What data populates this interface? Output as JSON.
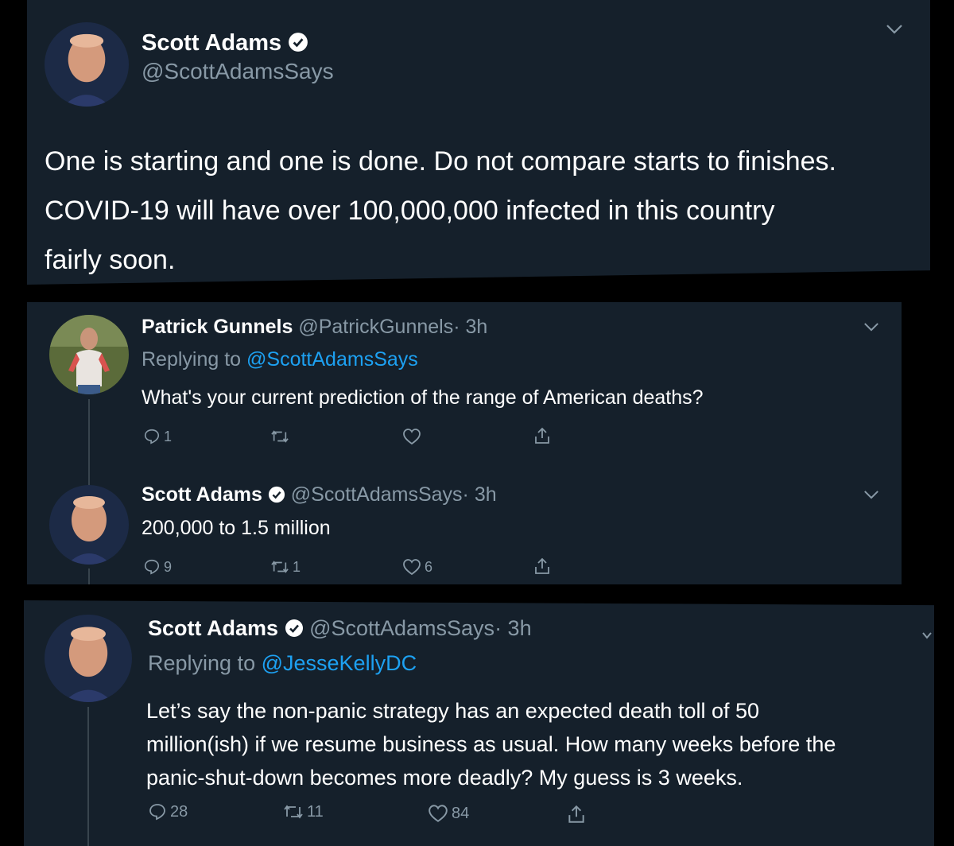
{
  "tweet_main": {
    "name": "Scott Adams",
    "handle": "@ScottAdamsSays",
    "text_lines": [
      "One is starting and one is done. Do not compare starts to finishes.",
      "COVID-19 will have over 100,000,000 infected in this country",
      "fairly soon."
    ]
  },
  "reply1": {
    "name": "Patrick Gunnels",
    "handle": "@PatrickGunnels",
    "time": "· 3h",
    "replying_prefix": "Replying to",
    "replying_to": "@ScottAdamsSays",
    "text": "What's your current prediction of the range of American deaths?",
    "replies": "1",
    "retweets": "",
    "likes": ""
  },
  "reply2": {
    "name": "Scott Adams",
    "handle": "@ScottAdamsSays",
    "time": "· 3h",
    "text": "200,000 to 1.5 million",
    "replies": "9",
    "retweets": "1",
    "likes": "6"
  },
  "reply3": {
    "name": "Scott Adams",
    "handle": "@ScottAdamsSays",
    "time": "· 3h",
    "replying_prefix": "Replying to",
    "replying_to": "@JesseKellyDC",
    "text_lines": [
      "Let’s say the non-panic strategy has an expected death toll of 50",
      "million(ish) if we resume business as usual. How many weeks before the",
      "panic-shut-down becomes more deadly? My guess is 3 weeks."
    ],
    "replies": "28",
    "retweets": "11",
    "likes": "84"
  },
  "icons": {
    "verified": "verified-badge-icon",
    "reply": "reply-icon",
    "retweet": "retweet-icon",
    "like": "like-icon",
    "share": "share-icon",
    "menu": "chevron-down-icon"
  },
  "colors": {
    "background": "#000000",
    "card": "#15202b",
    "text": "#ffffff",
    "secondary": "#8899a6",
    "link": "#1da1f2"
  }
}
